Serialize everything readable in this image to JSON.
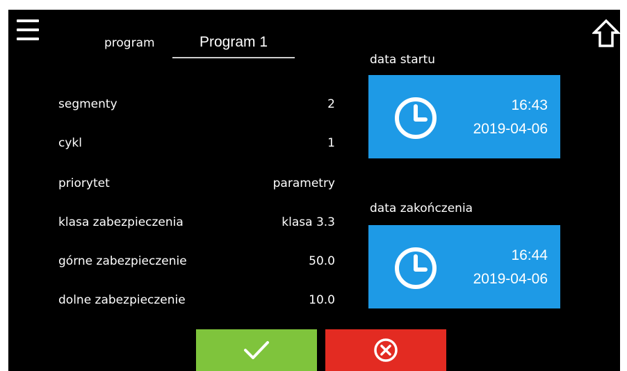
{
  "header": {
    "program_label": "program",
    "program_value": "Program 1"
  },
  "params": [
    {
      "label": "segmenty",
      "value": "2"
    },
    {
      "label": "cykl",
      "value": "1"
    },
    {
      "label": "priorytet",
      "value": "parametry"
    },
    {
      "label": "klasa zabezpieczenia",
      "value": "klasa 3.3"
    },
    {
      "label": "górne zabezpieczenie",
      "value": "50.0"
    },
    {
      "label": "dolne zabezpieczenie",
      "value": "10.0"
    }
  ],
  "start": {
    "label": "data startu",
    "time": "16:43",
    "date": "2019-04-06"
  },
  "end": {
    "label": "data zakończenia",
    "time": "16:44",
    "date": "2019-04-06"
  },
  "icons": {
    "menu": "hamburger-menu-icon",
    "home": "home-icon",
    "clock": "clock-icon",
    "confirm": "checkmark-icon",
    "cancel": "cancel-circle-x-icon"
  },
  "colors": {
    "background": "#000000",
    "date_box": "#1e9ae6",
    "confirm": "#7fc43c",
    "cancel": "#e32b22"
  }
}
